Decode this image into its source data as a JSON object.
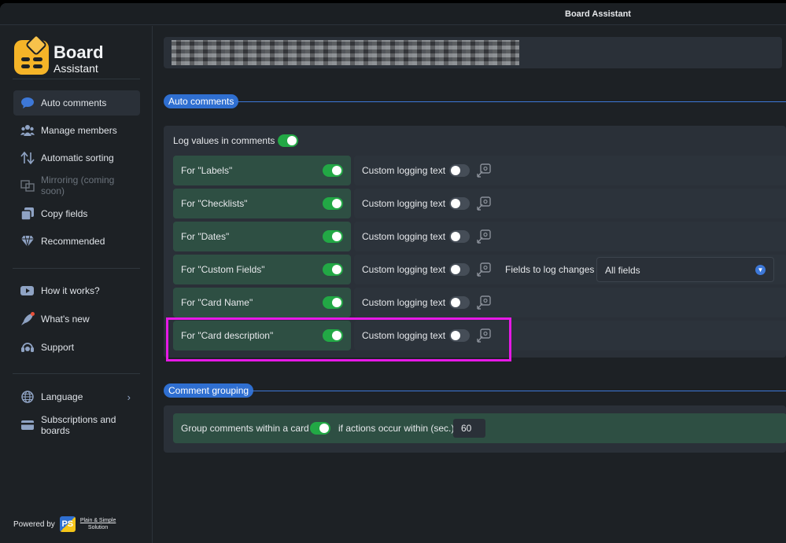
{
  "window": {
    "title": "Board Assistant"
  },
  "brand": {
    "name_line1": "Board",
    "name_line2": "Assistant"
  },
  "sidebar": {
    "items": [
      {
        "label": "Auto comments",
        "icon": "chat-bubble-icon",
        "active": true
      },
      {
        "label": "Manage members",
        "icon": "members-icon"
      },
      {
        "label": "Automatic sorting",
        "icon": "sort-arrows-icon"
      },
      {
        "label": "Mirroring (coming soon)",
        "icon": "mirror-icon",
        "disabled": true
      },
      {
        "label": "Copy fields",
        "icon": "copy-icon"
      },
      {
        "label": "Recommended",
        "icon": "diamond-icon"
      }
    ],
    "help_items": [
      {
        "label": "How it works?",
        "icon": "youtube-icon"
      },
      {
        "label": "What's new",
        "icon": "rocket-icon"
      },
      {
        "label": "Support",
        "icon": "support-icon"
      }
    ],
    "settings_items": [
      {
        "label": "Language",
        "icon": "globe-icon"
      },
      {
        "label": "Subscriptions and boards",
        "icon": "card-icon"
      }
    ],
    "powered_by": "Powered by",
    "company_line1": "Plain & Simple",
    "company_line2": "Solution",
    "company_badge": "PS"
  },
  "auto_comments": {
    "section_title": "Auto comments",
    "log_values_label": "Log values in comments",
    "log_values_on": true,
    "custom_text_label": "Custom logging text",
    "rows": [
      {
        "label": "For \"Labels\"",
        "on": true,
        "custom": false
      },
      {
        "label": "For \"Checklists\"",
        "on": true,
        "custom": false
      },
      {
        "label": "For \"Dates\"",
        "on": true,
        "custom": false
      },
      {
        "label": "For \"Custom Fields\"",
        "on": true,
        "custom": false
      },
      {
        "label": "For \"Card Name\"",
        "on": true,
        "custom": false
      },
      {
        "label": "For \"Card description\"",
        "on": true,
        "custom": false
      }
    ],
    "fields_to_log_label": "Fields to log changes",
    "fields_to_log_value": "All fields"
  },
  "comment_grouping": {
    "section_title": "Comment grouping",
    "group_label": "Group comments within a card",
    "group_on": true,
    "within_label": "if actions occur within (sec.)",
    "within_value": "60"
  },
  "colors": {
    "accent": "#2f6fd1",
    "toggle_on": "#22a845",
    "highlight": "#e619e6",
    "row_green": "#2e4f43"
  }
}
